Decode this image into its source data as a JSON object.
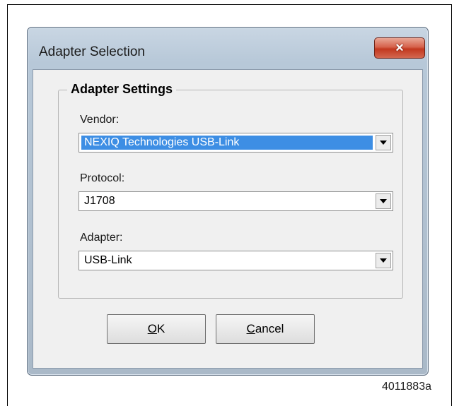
{
  "dialog": {
    "title": "Adapter Selection",
    "close_glyph": "×"
  },
  "group": {
    "title": "Adapter Settings",
    "vendor": {
      "label": "Vendor:",
      "value": "NEXIQ Technologies USB-Link",
      "selected": true
    },
    "protocol": {
      "label": "Protocol:",
      "value": "J1708"
    },
    "adapter": {
      "label": "Adapter:",
      "value": "USB-Link"
    }
  },
  "buttons": {
    "ok": {
      "mnemonic": "O",
      "rest": "K"
    },
    "cancel": {
      "mnemonic": "C",
      "rest": "ancel"
    }
  },
  "figure_id": "4011883a",
  "colors": {
    "selection": "#3d8ee4",
    "close_button": "#c2381f",
    "window_frame": "#b7c8d8"
  },
  "icons": {
    "dropdown": "chevron-down-icon",
    "close": "close-icon"
  }
}
